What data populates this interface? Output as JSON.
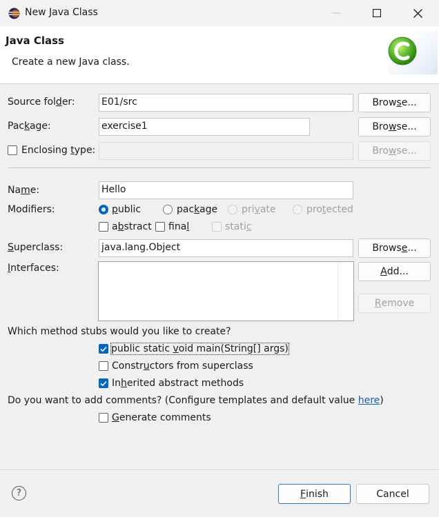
{
  "window": {
    "title": "New Java Class"
  },
  "banner": {
    "title": "Java Class",
    "description": "Create a new Java class."
  },
  "form": {
    "source_folder": {
      "label_pre": "Source fol",
      "label_acc": "d",
      "label_post": "er:",
      "value": "E01/src",
      "browse_pre": "Brow",
      "browse_acc": "s",
      "browse_post": "e..."
    },
    "package": {
      "label_pre": "Pac",
      "label_acc": "k",
      "label_post": "age:",
      "value": "exercise1",
      "browse_pre": "Bro",
      "browse_acc": "w",
      "browse_post": "se..."
    },
    "enclosing": {
      "label_pre": "Enclosing ",
      "label_acc": "t",
      "label_post": "ype:",
      "browse_pre": "Bro",
      "browse_acc": "w",
      "browse_post": "se..."
    },
    "name": {
      "label_pre": "Na",
      "label_acc": "m",
      "label_post": "e:",
      "value": "Hello"
    },
    "modifiers": {
      "label": "Modifiers:",
      "public": {
        "pre": "",
        "acc": "p",
        "post": "ublic"
      },
      "package": {
        "pre": "pac",
        "acc": "k",
        "post": "age"
      },
      "private": {
        "pre": "pri",
        "acc": "v",
        "post": "ate"
      },
      "protected": {
        "pre": "pro",
        "acc": "t",
        "post": "ected"
      },
      "abstract": {
        "pre": "a",
        "acc": "b",
        "post": "stract"
      },
      "final": {
        "pre": "fina",
        "acc": "l",
        "post": ""
      },
      "static": {
        "pre": "stati",
        "acc": "c",
        "post": ""
      }
    },
    "superclass": {
      "label_pre": "",
      "label_acc": "S",
      "label_post": "uperclass:",
      "value": "java.lang.Object",
      "browse_pre": "Brows",
      "browse_acc": "e",
      "browse_post": "..."
    },
    "interfaces": {
      "label_pre": "",
      "label_acc": "I",
      "label_post": "nterfaces:",
      "add_pre": "",
      "add_acc": "A",
      "add_post": "dd...",
      "remove_pre": "",
      "remove_acc": "R",
      "remove_post": "emove"
    }
  },
  "stubs": {
    "question": "Which method stubs would you like to create?",
    "main": {
      "pre": "public static ",
      "acc": "v",
      "post": "oid main(String[] args)",
      "checked": true
    },
    "constructors": {
      "pre": "Constr",
      "acc": "u",
      "post": "ctors from superclass",
      "checked": false
    },
    "inherited": {
      "pre": "In",
      "acc": "h",
      "post": "erited abstract methods",
      "checked": true
    }
  },
  "comments": {
    "question": "Do you want to add comments? (Configure templates and default value ",
    "link": "here",
    "question_end": ")",
    "generate": {
      "pre": "",
      "acc": "G",
      "post": "enerate comments",
      "checked": false
    }
  },
  "footer": {
    "help_symbol": "?",
    "finish": {
      "pre": "",
      "acc": "F",
      "post": "inish"
    },
    "cancel": "Cancel"
  }
}
